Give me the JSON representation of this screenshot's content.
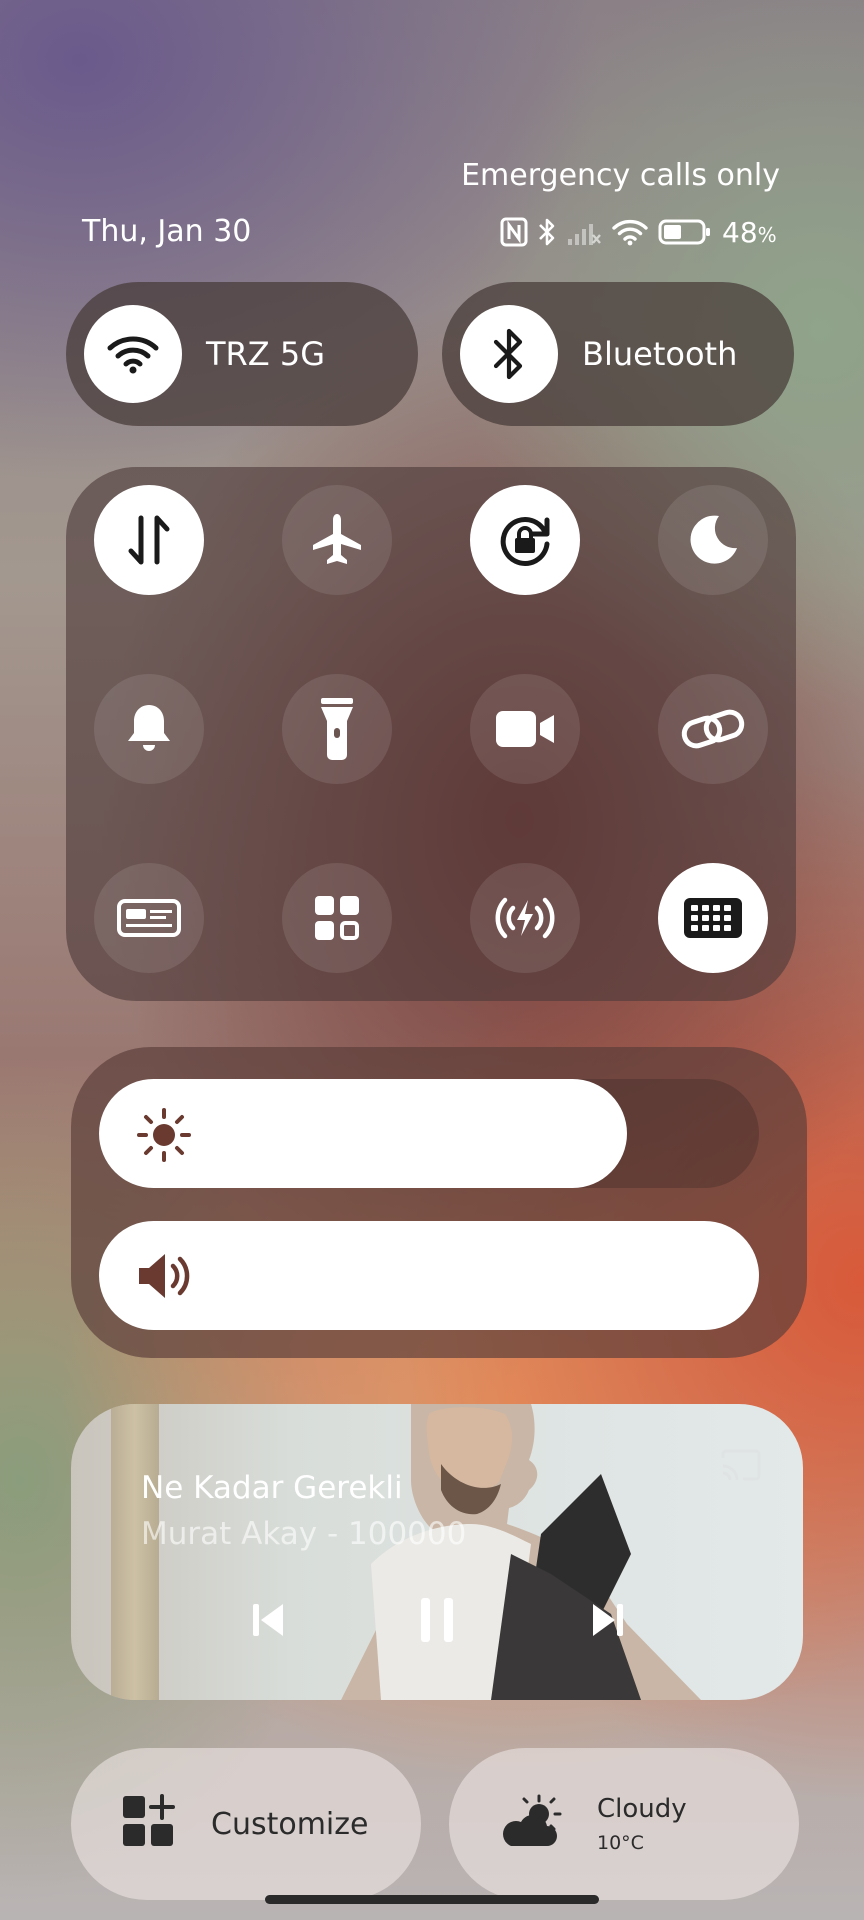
{
  "status": {
    "network_text": "Emergency calls only",
    "date": "Thu, Jan 30",
    "battery_percent": "48",
    "battery_unit": "%",
    "battery_level": 0.48,
    "icons": [
      "nfc-icon",
      "bluetooth-icon",
      "signal-off-icon",
      "wifi-icon",
      "battery-icon"
    ]
  },
  "top_toggles": {
    "wifi_label": "TRZ 5G",
    "bluetooth_label": "Bluetooth"
  },
  "tiles": [
    {
      "name": "mobile-data-icon",
      "on": true
    },
    {
      "name": "airplane-icon",
      "on": false
    },
    {
      "name": "rotation-lock-icon",
      "on": true
    },
    {
      "name": "moon-icon",
      "on": false
    },
    {
      "name": "bell-icon",
      "on": false
    },
    {
      "name": "flashlight-icon",
      "on": false
    },
    {
      "name": "video-camera-icon",
      "on": false
    },
    {
      "name": "link-icon",
      "on": false
    },
    {
      "name": "card-icon",
      "on": false
    },
    {
      "name": "apps-grid-icon",
      "on": false
    },
    {
      "name": "nearby-share-icon",
      "on": false
    },
    {
      "name": "keypad-icon",
      "on": true
    }
  ],
  "sliders": {
    "brightness_level": 0.8,
    "volume_level": 1.0,
    "brightness_icon": "sun-icon",
    "volume_icon": "speaker-icon"
  },
  "media": {
    "song": "Ne Kadar Gerekli",
    "artist": "Murat Akay - 100000",
    "controls": [
      "previous-icon",
      "pause-icon",
      "next-icon"
    ],
    "cast_icon": "cast-icon"
  },
  "bottom": {
    "customize_label": "Customize",
    "weather_condition": "Cloudy",
    "weather_temp": "10°C",
    "weather_icon": "partly-cloudy-icon"
  }
}
